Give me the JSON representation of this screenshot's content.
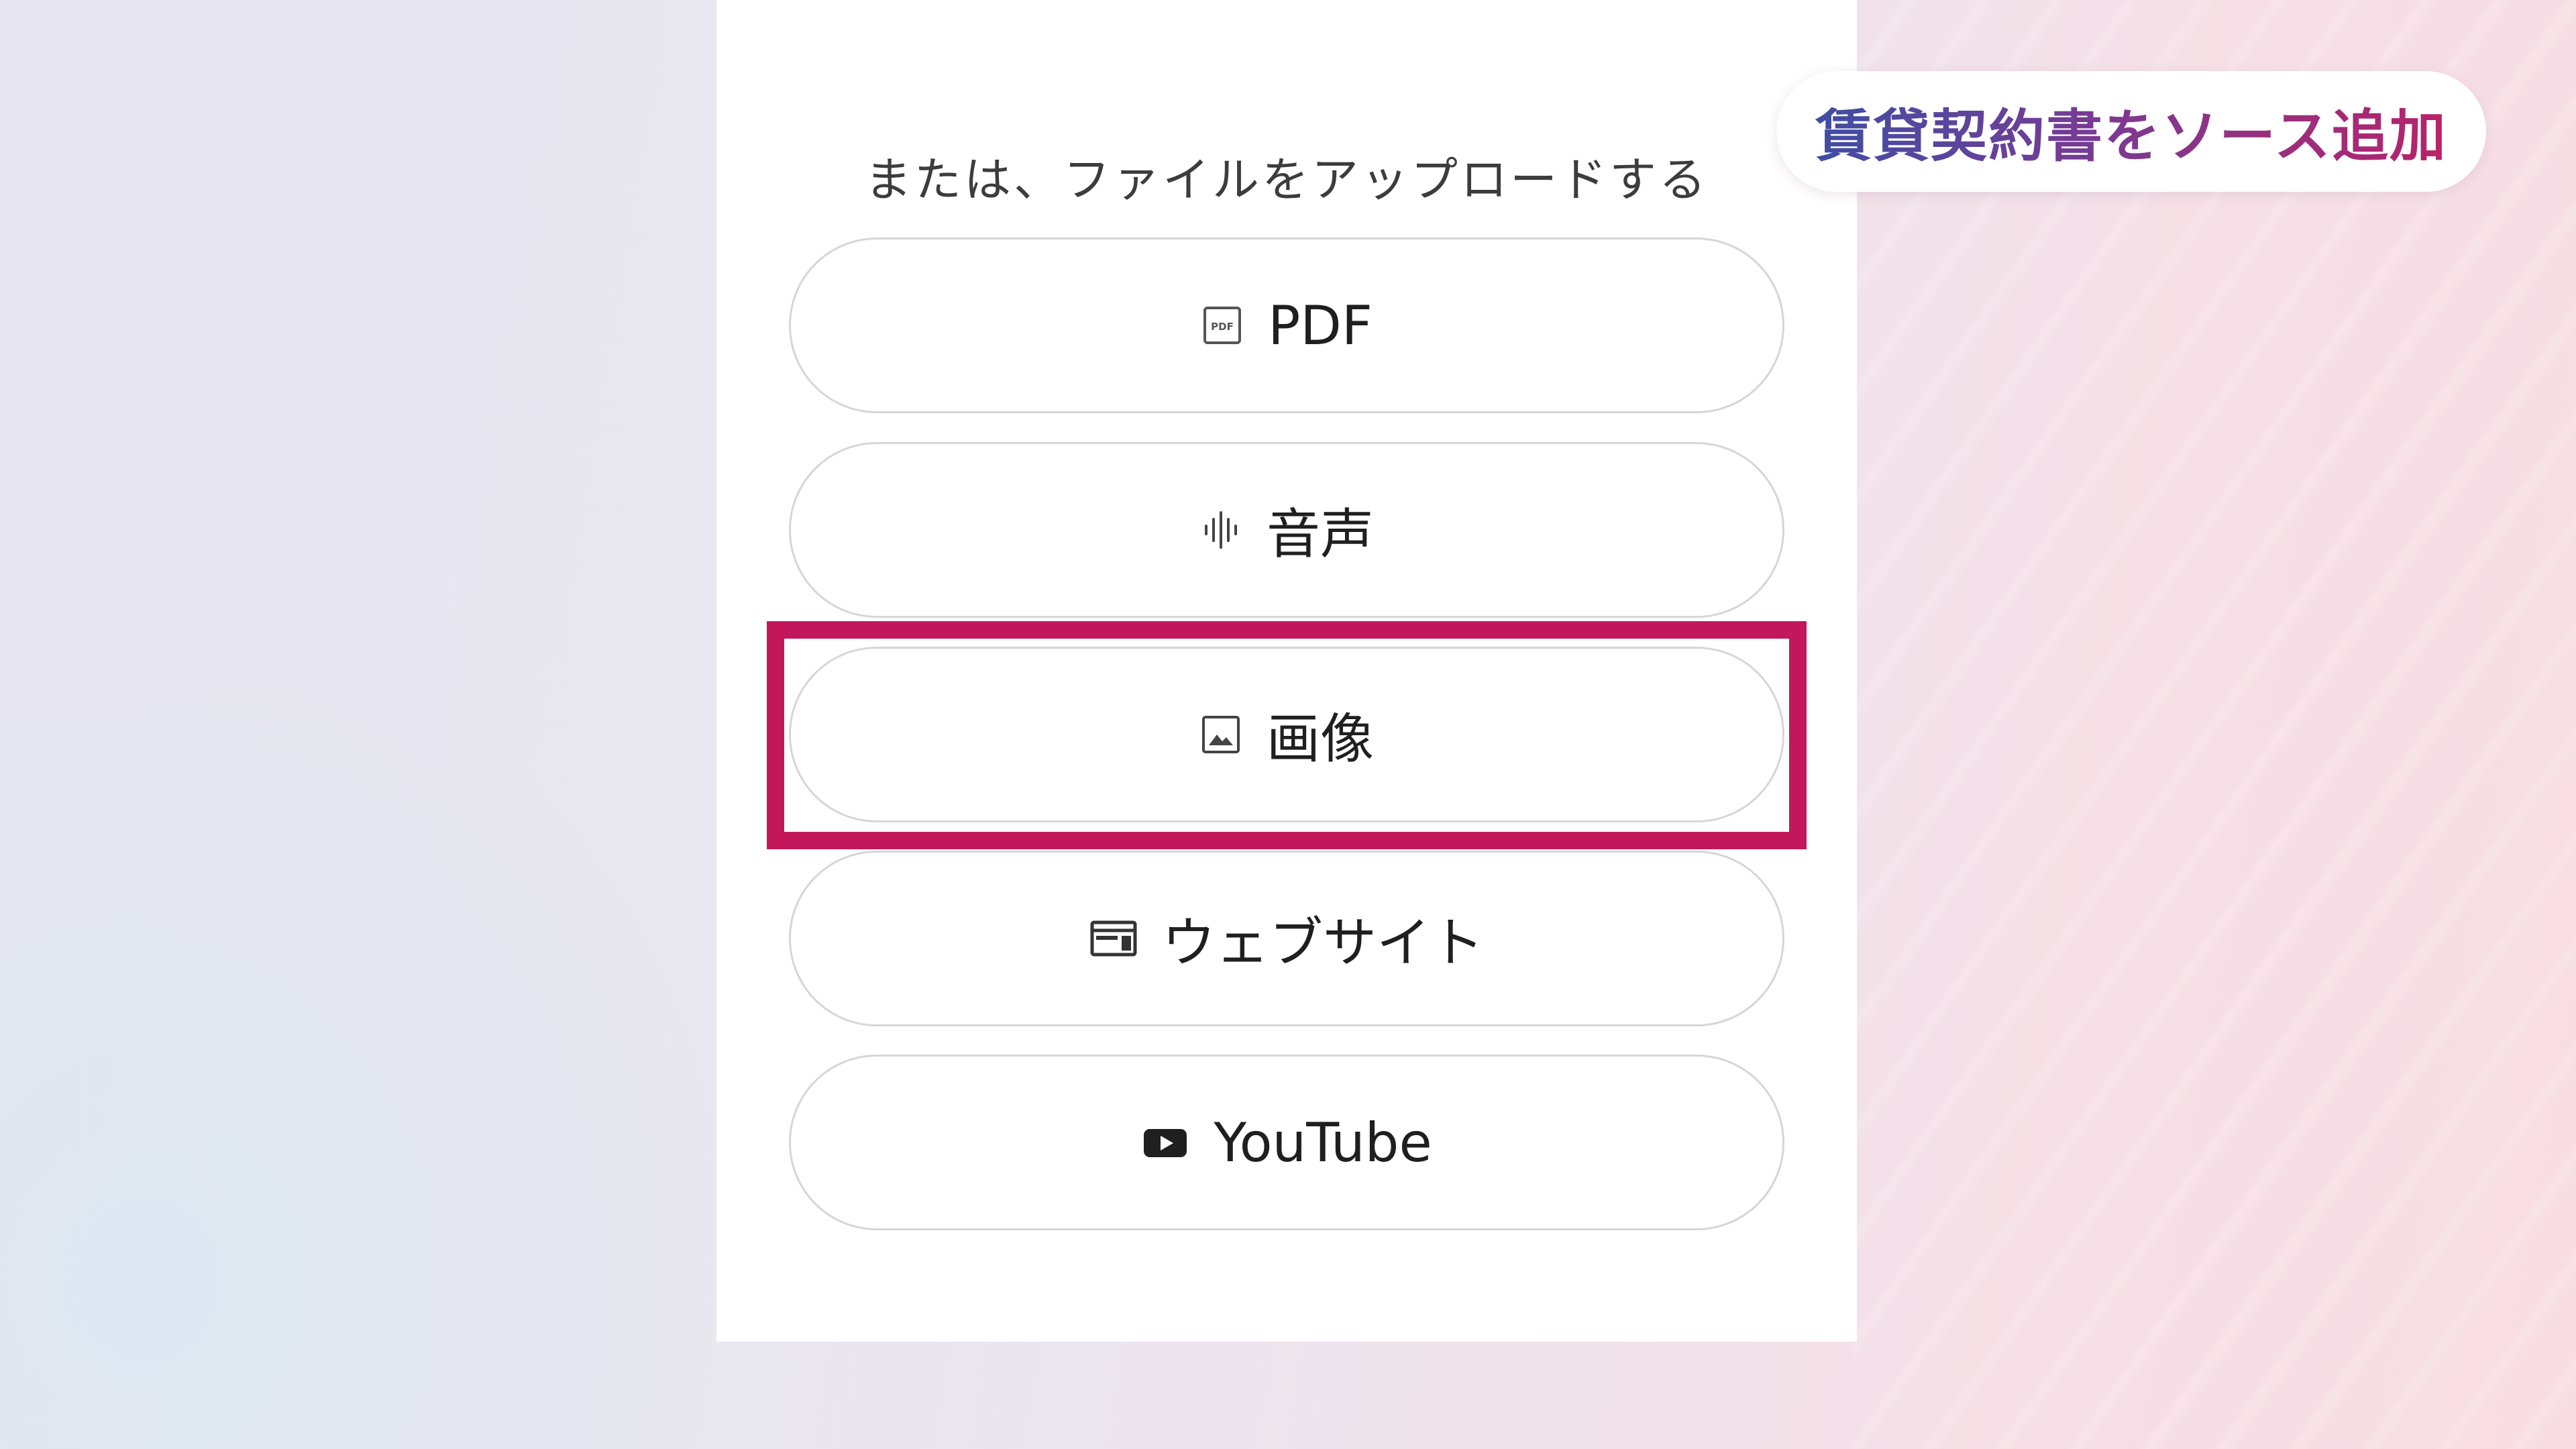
{
  "upload_section": {
    "title": "または、ファイルをアップロードする",
    "options": [
      {
        "label": "PDF",
        "icon": "pdf-icon"
      },
      {
        "label": "音声",
        "icon": "audio-waveform-icon"
      },
      {
        "label": "画像",
        "icon": "image-icon"
      },
      {
        "label": "ウェブサイト",
        "icon": "website-icon"
      },
      {
        "label": "YouTube",
        "icon": "youtube-icon"
      }
    ]
  },
  "caption": {
    "text": "賃貸契約書をソース追加"
  },
  "colors": {
    "highlight": "#c2185b",
    "caption_gradient_start": "#3f4ea3",
    "caption_gradient_end": "#b8236a",
    "button_border": "#d6d6d6",
    "panel_background": "#ffffff"
  }
}
